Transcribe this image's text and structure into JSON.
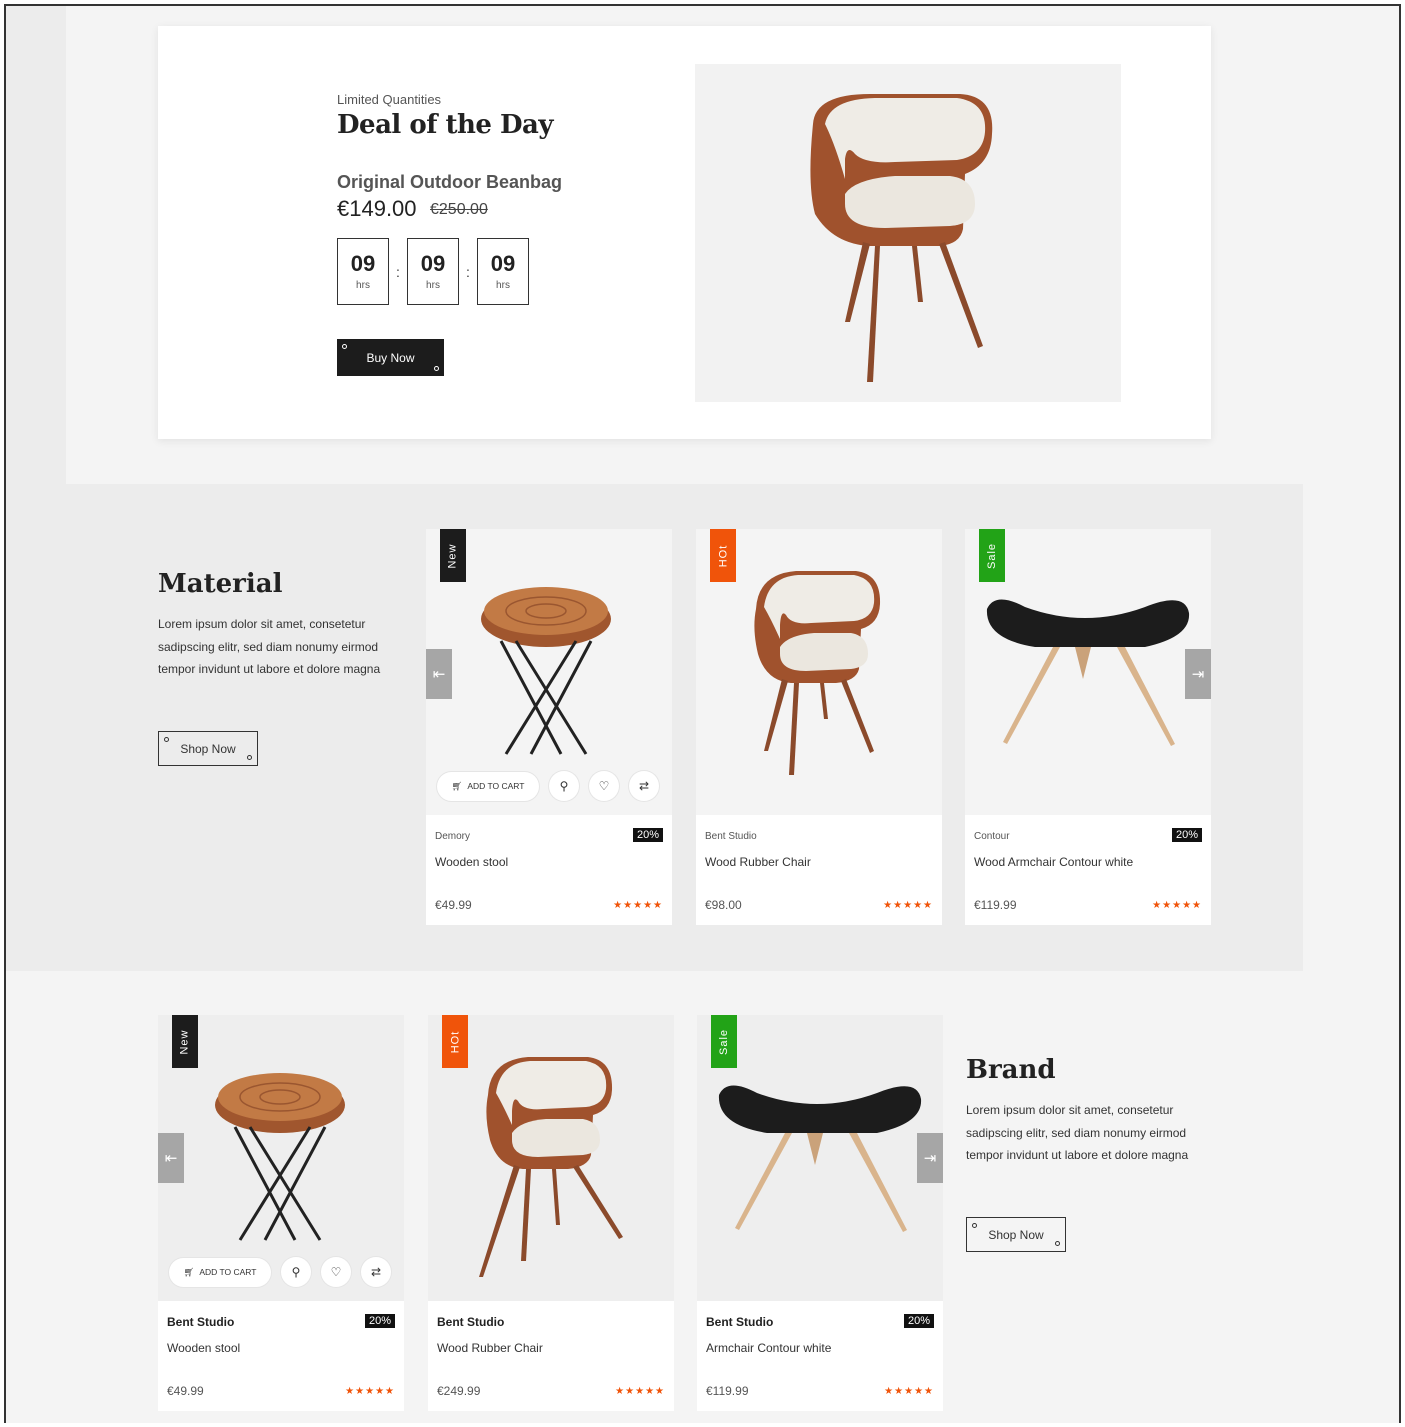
{
  "deal": {
    "subtitle": "Limited Quantities",
    "title": "Deal of the Day",
    "product": "Original Outdoor Beanbag",
    "price": "€149.00",
    "old_price": "€250.00",
    "timer": [
      {
        "value": "09",
        "label": "hrs"
      },
      {
        "value": "09",
        "label": "hrs"
      },
      {
        "value": "09",
        "label": "hrs"
      }
    ],
    "separator": ":",
    "button": "Buy Now"
  },
  "material": {
    "title": "Material",
    "text": "Lorem ipsum dolor sit amet, consetetur sadipscing elitr, sed diam nonumy eirmod tempor invidunt ut labore et dolore magna",
    "button": "Shop Now",
    "products": [
      {
        "badge": "New",
        "brand": "Demory",
        "discount": "20%",
        "name": "Wooden stool",
        "price": "€49.99",
        "rating": "★★★★★"
      },
      {
        "badge": "HOt",
        "brand": "Bent Studio",
        "discount": "",
        "name": "Wood Rubber Chair",
        "price": "€98.00",
        "rating": "★★★★★"
      },
      {
        "badge": "Sale",
        "brand": "Contour",
        "discount": "20%",
        "name": "Wood Armchair Contour white",
        "price": "€119.99",
        "rating": "★★★★★"
      }
    ]
  },
  "brand_section": {
    "title": "Brand",
    "text": "Lorem ipsum dolor sit amet, consetetur sadipscing elitr, sed diam nonumy eirmod tempor invidunt ut labore et dolore magna",
    "button": "Shop Now",
    "products": [
      {
        "badge": "New",
        "brand": "Bent Studio",
        "discount": "20%",
        "name": "Wooden stool",
        "price": "€49.99",
        "rating": "★★★★★"
      },
      {
        "badge": "HOt",
        "brand": "Bent Studio",
        "discount": "",
        "name": "Wood Rubber Chair",
        "price": "€249.99",
        "rating": "★★★★★"
      },
      {
        "badge": "Sale",
        "brand": "Bent Studio",
        "discount": "20%",
        "name": "Armchair Contour white",
        "price": "€119.99",
        "rating": "★★★★★"
      }
    ]
  },
  "card_actions": {
    "add_to_cart": "ADD TO CART",
    "icons": [
      "cart-icon",
      "search-icon",
      "heart-icon",
      "compare-icon"
    ]
  },
  "carousel": {
    "prev_icon": "chevron-left-icon",
    "next_icon": "chevron-right-icon"
  },
  "colors": {
    "badge_new": "#1c1c1c",
    "badge_hot": "#f0540a",
    "badge_sale": "#22a317",
    "stars": "#f0540a",
    "dark_button": "#1c1c1c"
  }
}
